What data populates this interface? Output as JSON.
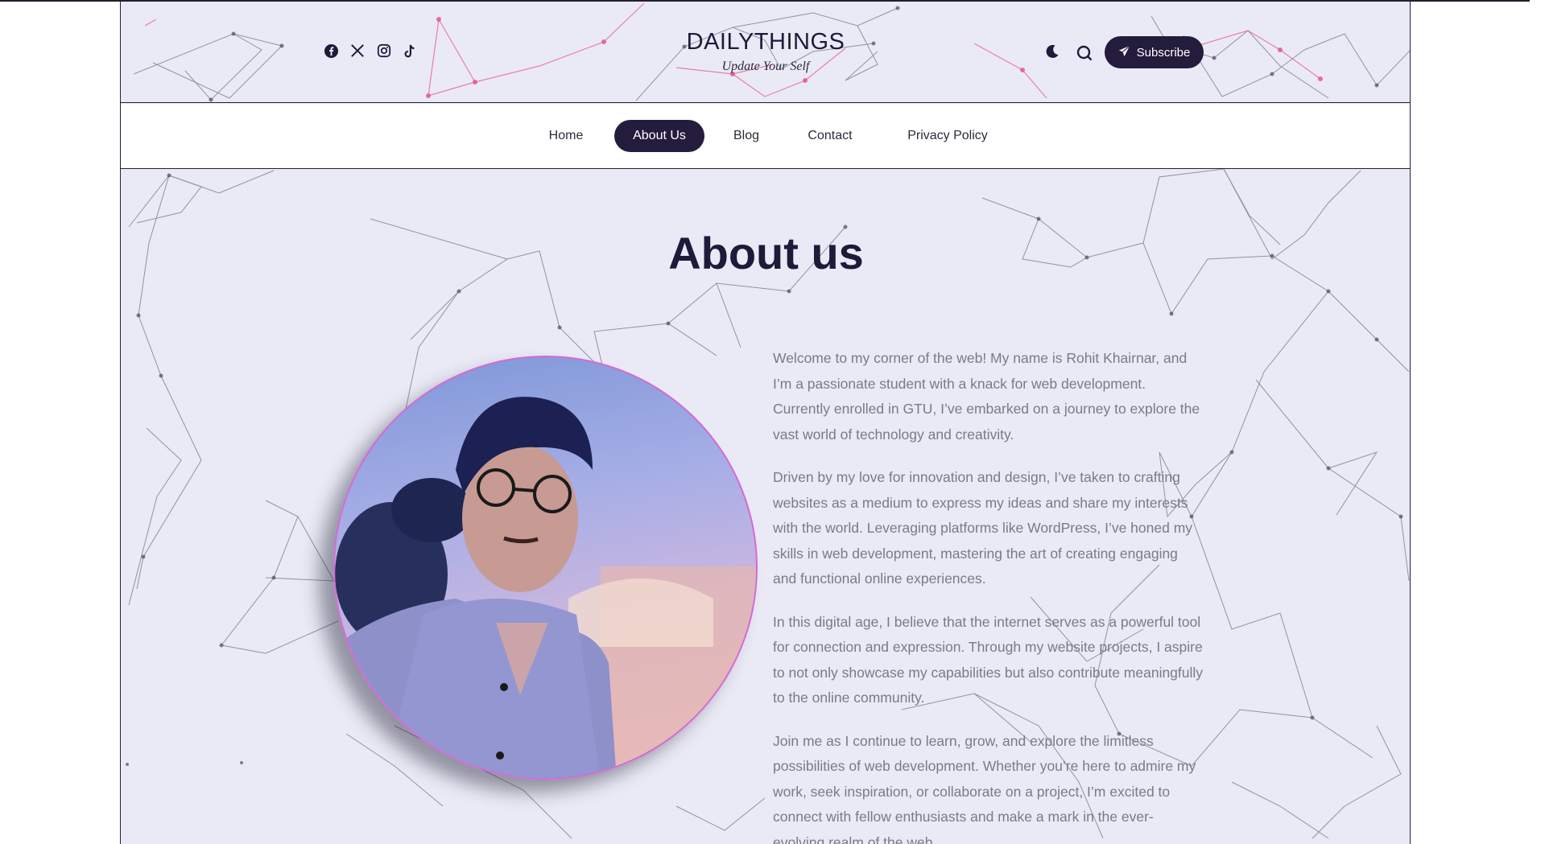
{
  "header": {
    "brand_title": "DAILYTHINGS",
    "tagline": "Update Your Self",
    "social_icons": [
      "facebook-icon",
      "x-icon",
      "instagram-icon",
      "tiktok-icon"
    ],
    "subscribe_label": "Subscribe"
  },
  "nav": {
    "items": [
      {
        "label": "Home",
        "active": false
      },
      {
        "label": "About Us",
        "active": true
      },
      {
        "label": "Blog",
        "active": false
      },
      {
        "label": "Contact",
        "active": false
      },
      {
        "label": "Privacy Policy",
        "active": false
      }
    ]
  },
  "main": {
    "heading": "About us",
    "paragraphs": [
      "Welcome to my corner of the web! My name is Rohit Khairnar, and I’m a passionate student with a knack for web development. Currently enrolled in GTU, I’ve embarked on a journey to explore the vast world of technology and creativity.",
      "Driven by my love for innovation and design, I’ve taken to crafting websites as a medium to express my ideas and share my interests with the world. Leveraging platforms like WordPress, I’ve honed my skills in web development, mastering the art of creating engaging and functional online experiences.",
      "In this digital age, I believe that the internet serves as a powerful tool for connection and expression. Through my website projects, I aspire to not only showcase my capabilities but also contribute meaningfully to the online community.",
      "Join me as I continue to learn, grow, and explore the limitless possibilities of web development. Whether you’re here to admire my work, seek inspiration, or collaborate on a project, I’m excited to connect with fellow enthusiasts and make a mark in the ever-evolving realm of the web."
    ]
  },
  "colors": {
    "accent_dark": "#231c3d",
    "page_bg": "#eaeaf6",
    "network_line": "#4a4a5a",
    "network_pink": "#e8508a"
  }
}
